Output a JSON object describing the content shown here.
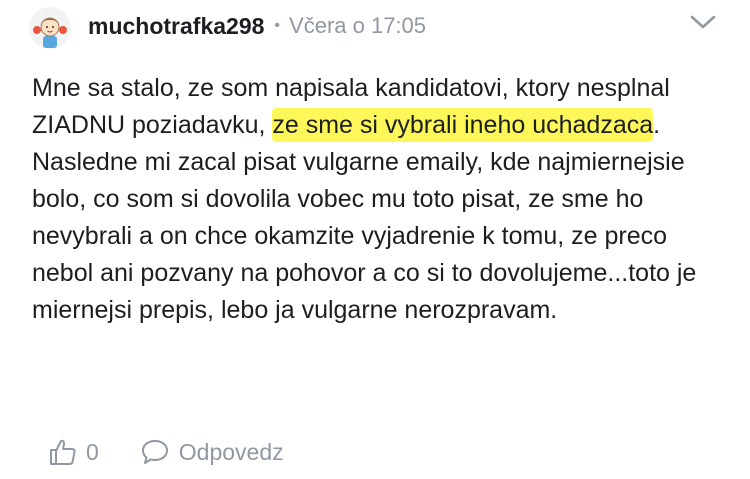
{
  "comment": {
    "username": "muchotrafka298",
    "separator": "•",
    "timestamp": "Včera o 17:05",
    "text_parts": [
      "Mne sa stalo, ze som napisala kandidatovi, ktory nesplnal ZIADNU poziadavku, ",
      "ze sme si vybrali ineho uchadzaca",
      ". Nasledne mi zacal pisat vulgarne emaily, kde najmiernejsie bolo, co som si dovolila vobec mu toto pisat, ze sme ho nevybrali a on chce okamzite vyjadrenie k tomu, ze preco nebol ani pozvany na pohovor a co si to dovolujeme...toto je miernejsi prepis, lebo ja vulgarne nerozpravam."
    ],
    "highlight_color": "#fdf75a"
  },
  "actions": {
    "like_count": "0",
    "reply_label": "Odpovedz"
  },
  "icons": {
    "avatar": "girl-avatar-icon",
    "menu": "chevron-down-icon",
    "like": "thumbs-up-icon",
    "reply": "speech-bubble-icon"
  },
  "colors": {
    "text": "#1c1e21",
    "muted": "#9197a3"
  }
}
